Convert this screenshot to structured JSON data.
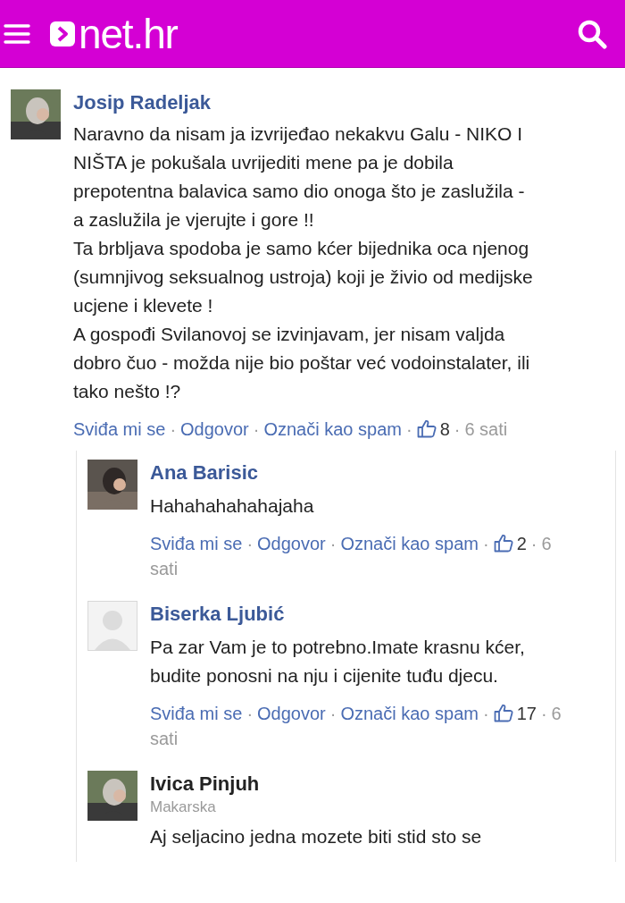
{
  "header": {
    "logo": "net.hr"
  },
  "separator": "·",
  "comments": [
    {
      "author": "Josip Radeljak",
      "paragraphs": [
        "Naravno da nisam ja izvrijeđao nekakvu Galu - NIKO I NIŠTA je pokušala uvrijediti mene pa je dobila prepotentna balavica samo dio onoga što je zaslužila - a zaslužila je vjerujte i gore !!",
        "Ta brbljava spodoba je samo kćer bijednika oca njenog (sumnjivog seksualnog ustroja) koji je živio od medijske ucjene i klevete !",
        "A gospođi Svilanovoj se izvinjavam, jer nisam valjda dobro čuo - možda nije bio poštar već vodoinstalater, ili tako nešto !?"
      ],
      "actions": {
        "like": "Sviđa mi se",
        "reply": "Odgovor",
        "spam": "Označi kao spam",
        "likes": "8",
        "time": "6 sati"
      },
      "replies": [
        {
          "author": "Ana Barisic",
          "paragraphs": [
            "Hahahahahahajaha"
          ],
          "actions": {
            "like": "Sviđa mi se",
            "reply": "Odgovor",
            "spam": "Označi kao spam",
            "likes": "2",
            "time": "6 sati"
          }
        },
        {
          "author": "Biserka Ljubić",
          "avatar": {
            "kind": "default"
          },
          "paragraphs": [
            "Pa zar Vam je to potrebno.Imate krasnu kćer, budite ponosni na nju i cijenite tuđu djecu."
          ],
          "actions": {
            "like": "Sviđa mi se",
            "reply": "Odgovor",
            "spam": "Označi kao spam",
            "likes": "17",
            "time": "6 sati"
          }
        },
        {
          "author": "Ivica Pinjuh",
          "location": "Makarska",
          "paragraphs": [
            "Aj seljacino jedna mozete biti stid sto se"
          ]
        }
      ]
    }
  ]
}
